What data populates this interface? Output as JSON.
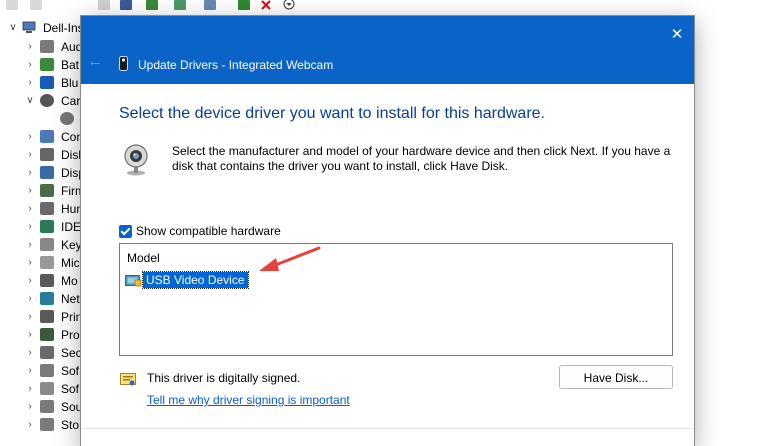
{
  "background": {
    "tree_root": "Dell-Ins",
    "tree_items": [
      "Aud",
      "Bat",
      "Blu",
      "Car",
      "",
      "Con",
      "Disk",
      "Disp",
      "Firm",
      "Hum",
      "IDE",
      "Key",
      "Mic",
      "Mo",
      "Net",
      "Prin",
      "Pro",
      "Sec",
      "Sof",
      "Sof",
      "Sou",
      "Sto"
    ]
  },
  "dialog": {
    "back_icon": "←",
    "close_icon": "✕",
    "title": "Update Drivers - Integrated Webcam",
    "heading": "Select the device driver you want to install for this hardware.",
    "instructions": "Select the manufacturer and model of your hardware device and then click Next. If you have a disk that contains the driver you want to install, click Have Disk.",
    "show_compatible_label": "Show compatible hardware",
    "model_header": "Model",
    "model_selected": "USB Video Device",
    "signed_text": "This driver is digitally signed.",
    "signing_link": "Tell me why driver signing is important",
    "have_disk_label": "Have Disk..."
  },
  "colors": {
    "titlebar": "#0a64c8",
    "heading": "#0a3c8c",
    "selection": "#0066d6",
    "link": "#0a5bd0",
    "annotation_arrow": "#e8413a"
  },
  "icons": {
    "close": "close-icon",
    "back": "back-arrow-icon",
    "webcam": "webcam-icon",
    "model": "monitor-device-icon",
    "certificate": "certificate-icon",
    "annotation": "red-arrow-icon"
  }
}
